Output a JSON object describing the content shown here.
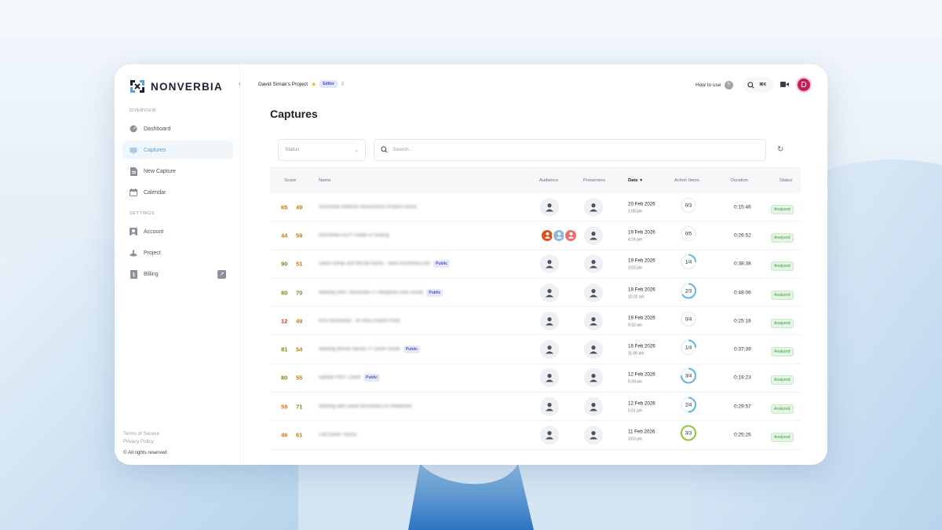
{
  "brand": {
    "name": "NONVERBIA"
  },
  "sidebar": {
    "overview_label": "OVERVIEW",
    "settings_label": "SETTINGS",
    "items": [
      {
        "label": "Dashboard",
        "icon": "dashboard-icon",
        "active": false
      },
      {
        "label": "Captures",
        "icon": "captures-icon",
        "active": true
      },
      {
        "label": "New Capture",
        "icon": "new-capture-icon",
        "active": false
      },
      {
        "label": "Calendar",
        "icon": "calendar-icon",
        "active": false
      }
    ],
    "settings_items": [
      {
        "label": "Account",
        "icon": "account-icon"
      },
      {
        "label": "Project",
        "icon": "project-icon"
      },
      {
        "label": "Billing",
        "icon": "billing-icon"
      }
    ],
    "footer": {
      "terms": "Terms of Service",
      "privacy": "Privacy Policy",
      "rights": "© All rights reserved"
    }
  },
  "topbar": {
    "project_name": "David Simak's Project",
    "role_badge": "Editor",
    "how_to_use": "How to use",
    "help_glyph": "?",
    "shortcut": "⌘K",
    "avatar_initial": "D"
  },
  "page": {
    "title": "Captures"
  },
  "filters": {
    "status_placeholder": "Status",
    "search_placeholder": "Search..."
  },
  "table": {
    "headers": {
      "score": "Score",
      "name": "Name",
      "audience": "Audience",
      "presenters": "Presenters",
      "date": "Date",
      "action_items": "Action Items",
      "duration": "Duration",
      "status": "Status"
    },
    "rows": [
      {
        "score_a": "65",
        "score_b": "49",
        "name": "Nonverbia Website NeuroDemo Product Demo",
        "public": false,
        "audience": "single",
        "date": "20 Feb 2026",
        "time": "1:08 pm",
        "action_items": "0/3",
        "progress": 0,
        "duration": "0:15:46",
        "status": "Analyzed"
      },
      {
        "score_a": "44",
        "score_b": "59",
        "name": "Nonverbia GCP Credits & Scaling",
        "public": false,
        "audience": "multi",
        "date": "19 Feb 2026",
        "time": "4:24 pm",
        "action_items": "0/5",
        "progress": 0,
        "duration": "0:26:52",
        "status": "Analyzed"
      },
      {
        "score_a": "90",
        "score_b": "51",
        "name": "David Simak and Michal Kanes - www.nonverbia.com",
        "public": true,
        "audience": "single",
        "date": "19 Feb 2026",
        "time": "3:03 pm",
        "action_items": "1/4",
        "progress": 0.25,
        "duration": "0:38:38",
        "status": "Analyzed"
      },
      {
        "score_a": "80",
        "score_b": "70",
        "name": "Meeting Intro: Nonverbia <> Mustpola (Site Scout)",
        "public": true,
        "audience": "single",
        "date": "19 Feb 2026",
        "time": "10:32 am",
        "action_items": "2/3",
        "progress": 0.6667,
        "duration": "0:48:06",
        "status": "Analyzed"
      },
      {
        "score_a": "12",
        "score_b": "49",
        "name": "Intro Nonverbia - 30 mins (Panel Pivot)",
        "public": false,
        "audience": "single",
        "date": "19 Feb 2026",
        "time": "9:33 am",
        "action_items": "0/4",
        "progress": 0,
        "duration": "0:25:16",
        "status": "Analyzed"
      },
      {
        "score_a": "81",
        "score_b": "54",
        "name": "Meeting Michal Vacula <> David Simak",
        "public": true,
        "audience": "single",
        "date": "16 Feb 2026",
        "time": "11:00 am",
        "action_items": "1/4",
        "progress": 0.25,
        "duration": "0:37:39",
        "status": "Analyzed"
      },
      {
        "score_a": "80",
        "score_b": "55",
        "name": "Update Pitch: David",
        "public": true,
        "audience": "single",
        "date": "12 Feb 2026",
        "time": "5:39 pm",
        "action_items": "3/4",
        "progress": 0.75,
        "duration": "0:19:23",
        "status": "Analyzed"
      },
      {
        "score_a": "59",
        "score_b": "71",
        "name": "Meeting with David Nonverbia UX Redefined",
        "public": false,
        "audience": "single",
        "date": "12 Feb 2026",
        "time": "5:01 pm",
        "action_items": "2/4",
        "progress": 0.5,
        "duration": "0:29:57",
        "status": "Analyzed"
      },
      {
        "score_a": "46",
        "score_b": "61",
        "name": "Call David- Huzza",
        "public": false,
        "audience": "single",
        "date": "11 Feb 2026",
        "time": "3:03 pm",
        "action_items": "3/3",
        "progress": 1,
        "duration": "0:25:26",
        "status": "Analyzed"
      }
    ]
  },
  "colors": {
    "accent": "#5aa0d8",
    "ring_partial": "#5db6e6",
    "ring_complete": "#8cc63f",
    "avatar": "#c21f54",
    "score_high": "#6d8f1c",
    "score_mid": "#c8780a",
    "score_low": "#d0341e"
  }
}
